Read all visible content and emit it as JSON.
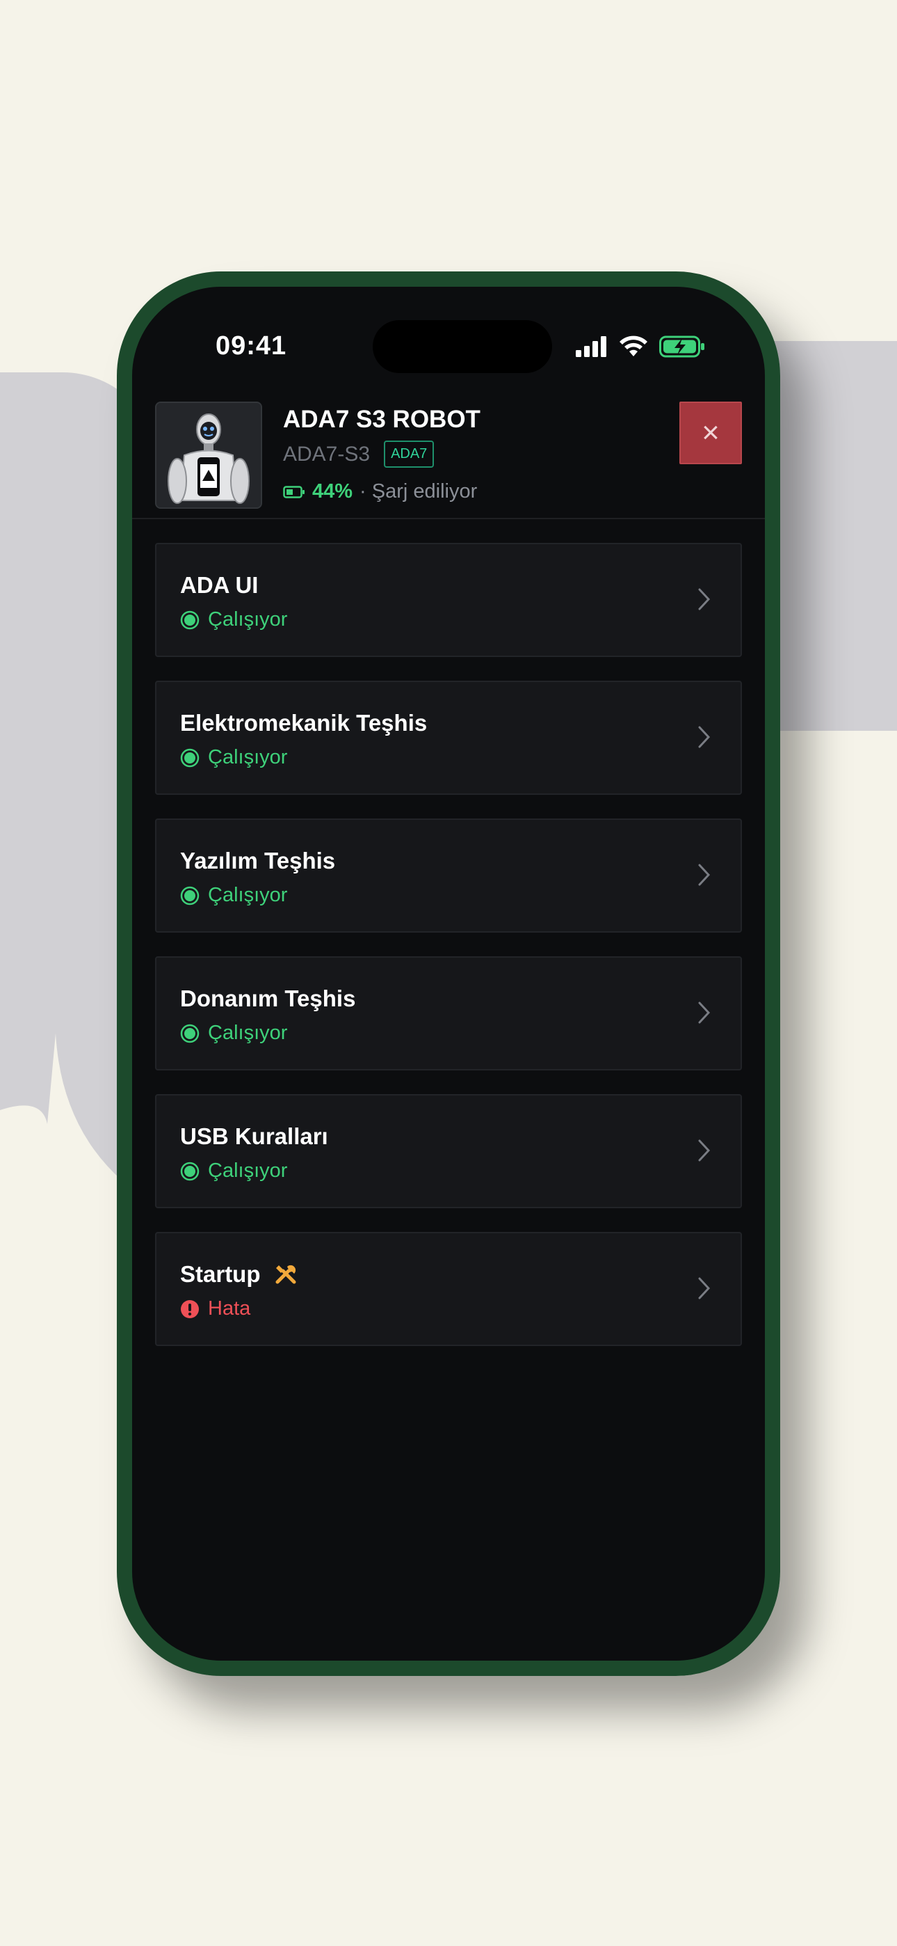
{
  "status_bar": {
    "time": "09:41",
    "icons": [
      "signal-icon",
      "wifi-icon",
      "battery-charging-icon"
    ]
  },
  "header": {
    "title": "ADA7 S3 ROBOT",
    "device_id": "ADA7-S3",
    "badge": "ADA7",
    "battery_percent": "44%",
    "charging_text": "· Şarj ediliyor",
    "close_label": "×"
  },
  "items": [
    {
      "name": "ADA UI",
      "status": "Çalışıyor",
      "state": "ok"
    },
    {
      "name": "Elektromekanik Teşhis",
      "status": "Çalışıyor",
      "state": "ok"
    },
    {
      "name": "Yazılım Teşhis",
      "status": "Çalışıyor",
      "state": "ok"
    },
    {
      "name": "Donanım Teşhis",
      "status": "Çalışıyor",
      "state": "ok"
    },
    {
      "name": "USB Kuralları",
      "status": "Çalışıyor",
      "state": "ok"
    },
    {
      "name": "Startup",
      "status": "Hata",
      "state": "error",
      "extra_icon": "tools-icon"
    }
  ],
  "colors": {
    "accent_ok": "#3ed17a",
    "accent_error": "#ef5057",
    "close_button": "#a5373e",
    "phone_frame": "#1c4a2c"
  }
}
